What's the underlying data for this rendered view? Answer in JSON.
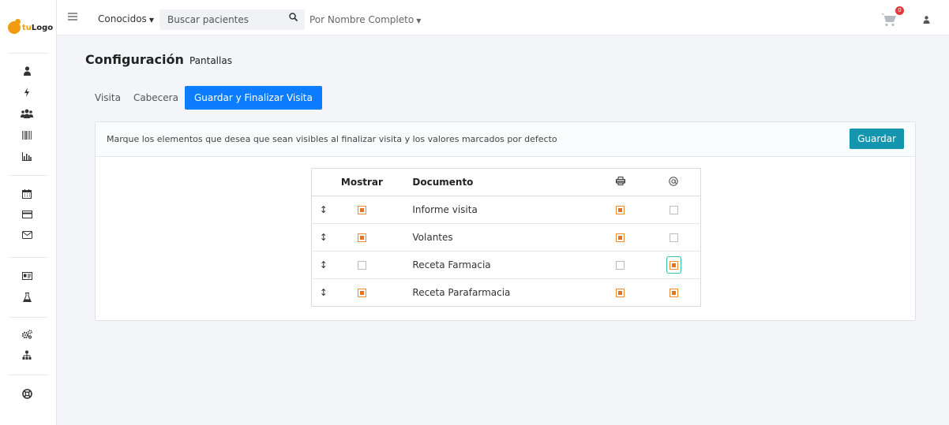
{
  "logo": {
    "prefix": "tu",
    "text": "Logo"
  },
  "sidebar": {
    "groups": [
      [
        "user-icon",
        "bolt-icon",
        "users-icon",
        "barcode-icon",
        "chart-icon"
      ],
      [
        "calendar-icon",
        "card-icon",
        "envelope-icon"
      ],
      [
        "id-card-icon",
        "flask-icon"
      ],
      [
        "cogs-icon",
        "sitemap-icon"
      ],
      [
        "lifebuoy-icon"
      ]
    ]
  },
  "topbar": {
    "known_label": "Conocidos",
    "search_placeholder": "Buscar pacientes",
    "mode_label": "Por Nombre Completo",
    "cart_count": "0"
  },
  "page": {
    "title": "Configuración",
    "subtitle": "Pantallas"
  },
  "tabs": [
    {
      "label": "Visita",
      "active": false
    },
    {
      "label": "Cabecera",
      "active": false
    },
    {
      "label": "Guardar y Finalizar Visita",
      "active": true
    }
  ],
  "card": {
    "instruction": "Marque los elementos que desea que sean visibles al finalizar visita y los valores marcados por defecto",
    "save_label": "Guardar"
  },
  "table": {
    "headers": {
      "show": "Mostrar",
      "document": "Documento",
      "print_icon": "printer-icon",
      "mail_icon": "at-icon"
    },
    "rows": [
      {
        "document": "Informe visita",
        "show": true,
        "print": true,
        "mail": false
      },
      {
        "document": "Volantes",
        "show": true,
        "print": true,
        "mail": false
      },
      {
        "document": "Receta Farmacia",
        "show": false,
        "print": false,
        "mail": true
      },
      {
        "document": "Receta Parafarmacia",
        "show": true,
        "print": true,
        "mail": true
      }
    ]
  },
  "colors": {
    "accent": "#0d7dff",
    "save": "#1596ae",
    "check": "#e8731f"
  }
}
